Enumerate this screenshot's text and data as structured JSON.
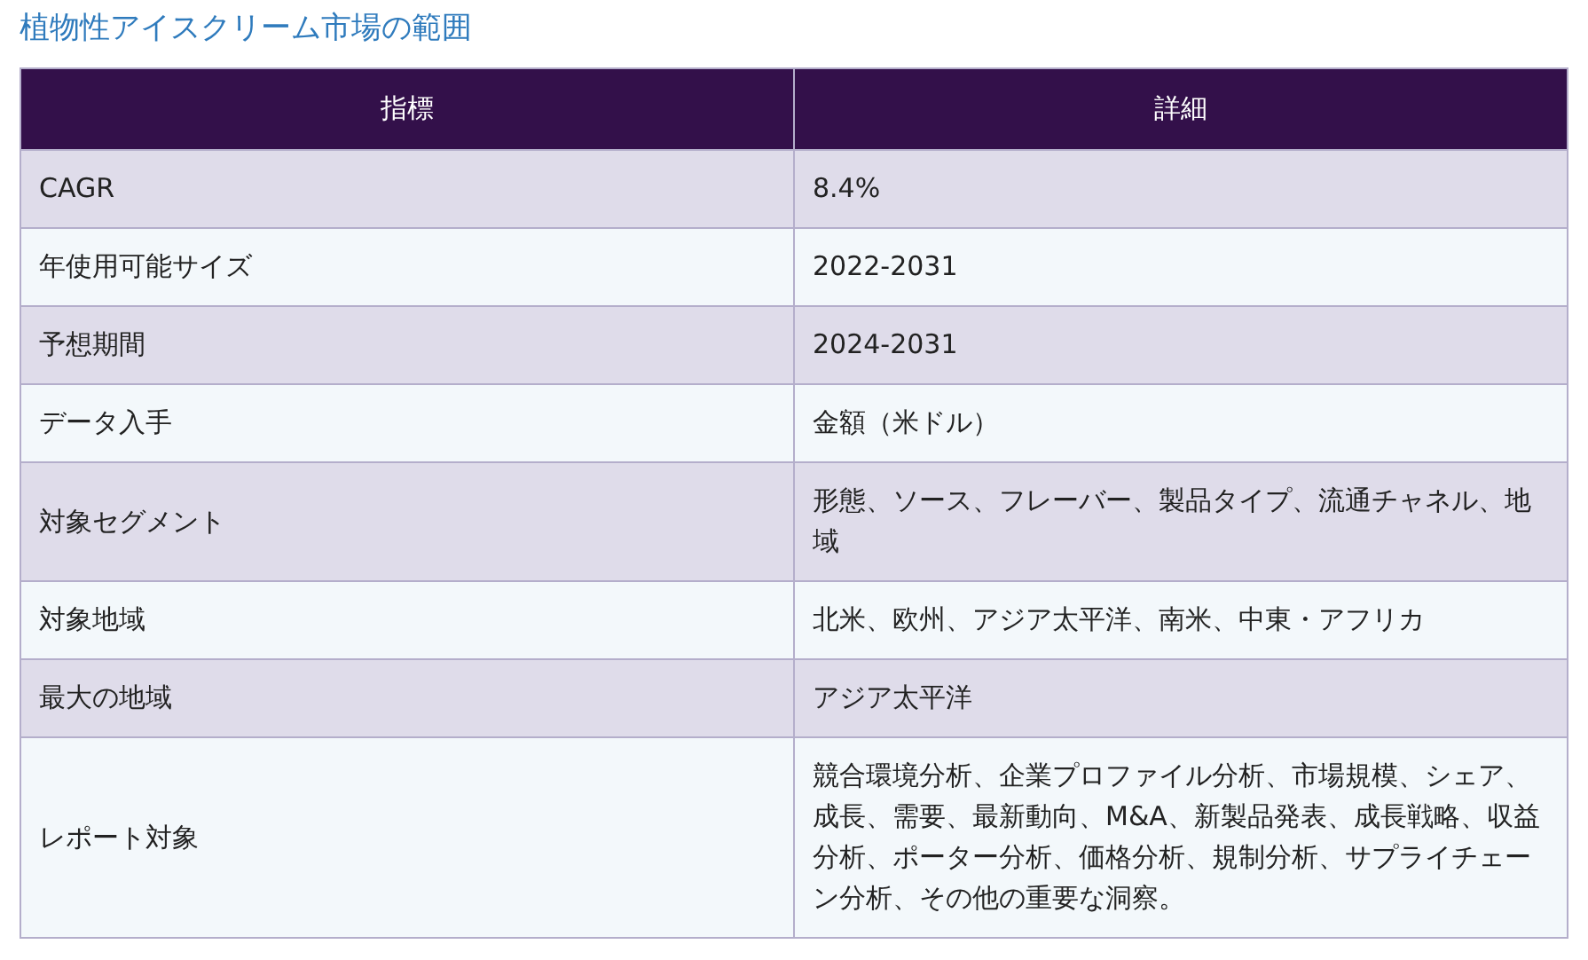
{
  "title": "植物性アイスクリーム市場の範囲",
  "table": {
    "columns": [
      "指標",
      "詳細"
    ],
    "rows": [
      [
        "CAGR",
        "8.4%"
      ],
      [
        "年使用可能サイズ",
        "2022-2031"
      ],
      [
        "予想期間",
        "2024-2031"
      ],
      [
        "データ入手",
        "金額（米ドル）"
      ],
      [
        "対象セグメント",
        "形態、ソース、フレーバー、製品タイプ、流通チャネル、地域"
      ],
      [
        "対象地域",
        "北米、欧州、アジア太平洋、南米、中東・アフリカ"
      ],
      [
        "最大の地域",
        "アジア太平洋"
      ],
      [
        "レポート対象",
        "競合環境分析、企業プロファイル分析、市場規模、シェア、成長、需要、最新動向、M&A、新製品発表、成長戦略、収益分析、ポーター分析、価格分析、規制分析、サプライチェーン分析、その他の重要な洞察。"
      ]
    ]
  }
}
